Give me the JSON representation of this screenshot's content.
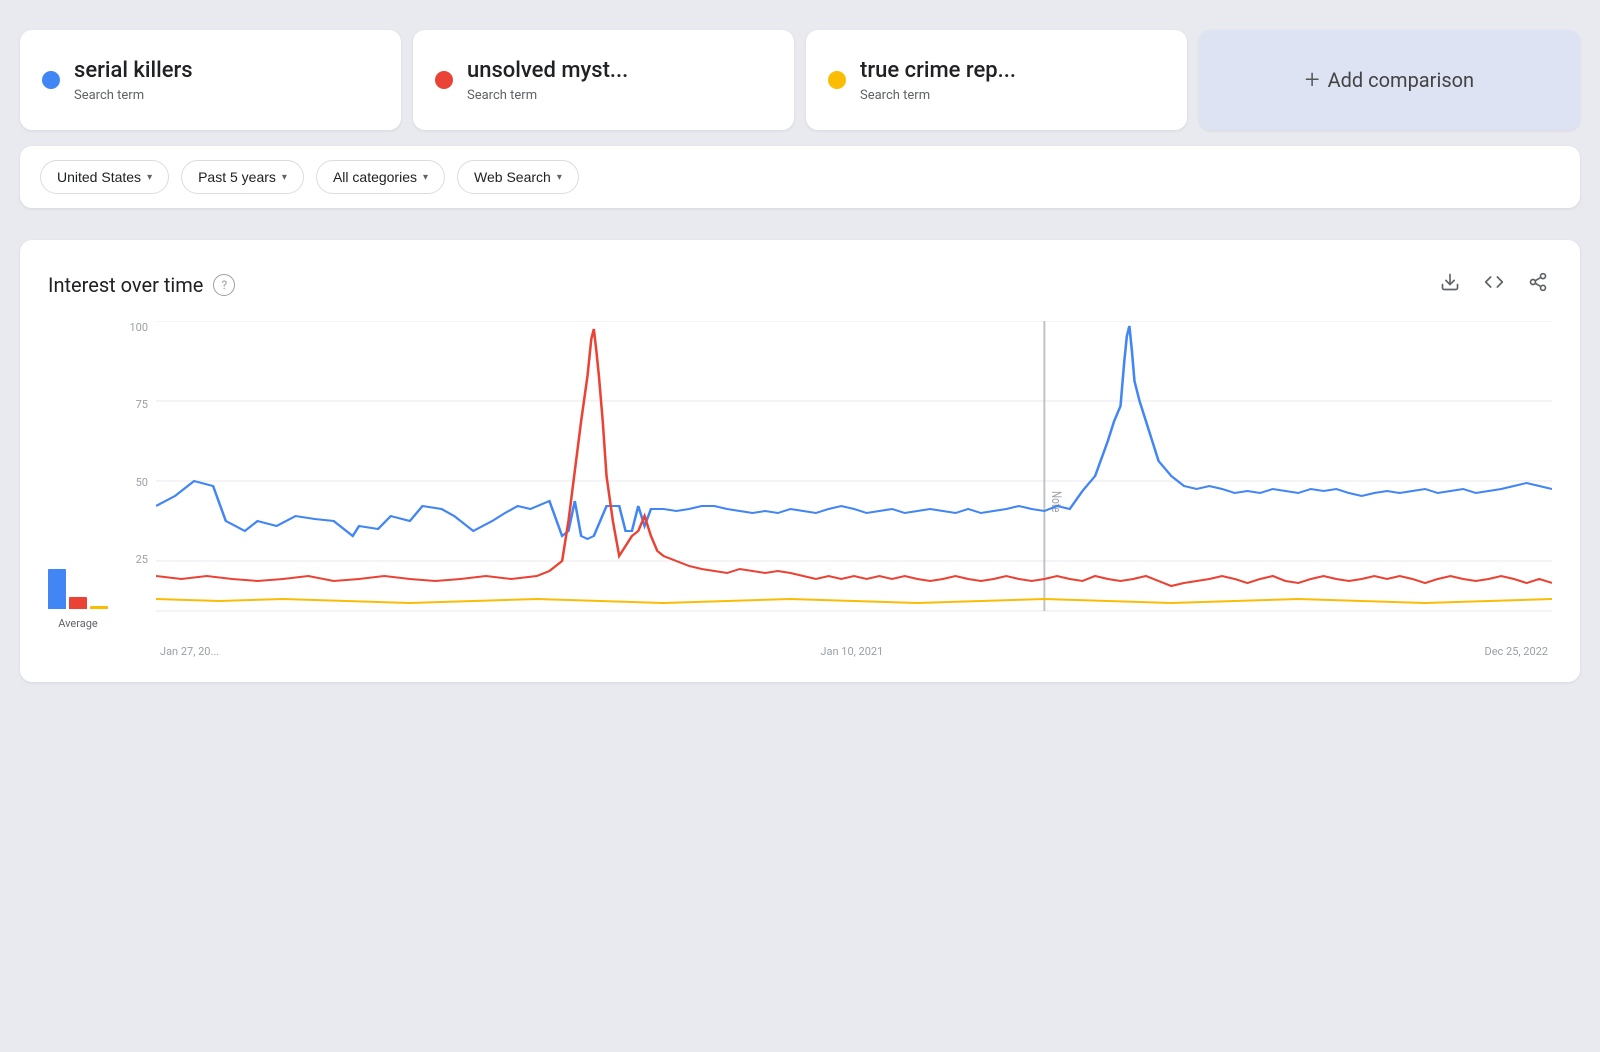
{
  "searchTerms": [
    {
      "id": "serial-killers",
      "name": "serial killers",
      "type": "Search term",
      "color": "#4285f4"
    },
    {
      "id": "unsolved-mysteries",
      "name": "unsolved myst...",
      "type": "Search term",
      "color": "#ea4335"
    },
    {
      "id": "true-crime-rep",
      "name": "true crime rep...",
      "type": "Search term",
      "color": "#fbbc04"
    }
  ],
  "addComparison": {
    "label": "Add comparison"
  },
  "filters": {
    "location": "United States",
    "timeRange": "Past 5 years",
    "category": "All categories",
    "searchType": "Web Search"
  },
  "chart": {
    "title": "Interest over time",
    "yLabels": [
      "100",
      "75",
      "50",
      "25"
    ],
    "xLabels": [
      "Jan 27, 20...",
      "Jan 10, 2021",
      "Dec 25, 2022"
    ],
    "noteLine": "Note",
    "legendLabel": "Average",
    "legendBars": [
      {
        "color": "#4285f4",
        "heightPct": 80
      },
      {
        "color": "#ea4335",
        "heightPct": 25
      },
      {
        "color": "#fbbc04",
        "heightPct": 5
      }
    ]
  },
  "icons": {
    "download": "⬇",
    "embed": "<>",
    "share": "↗",
    "help": "?",
    "chevron": "▾",
    "plus": "+"
  }
}
